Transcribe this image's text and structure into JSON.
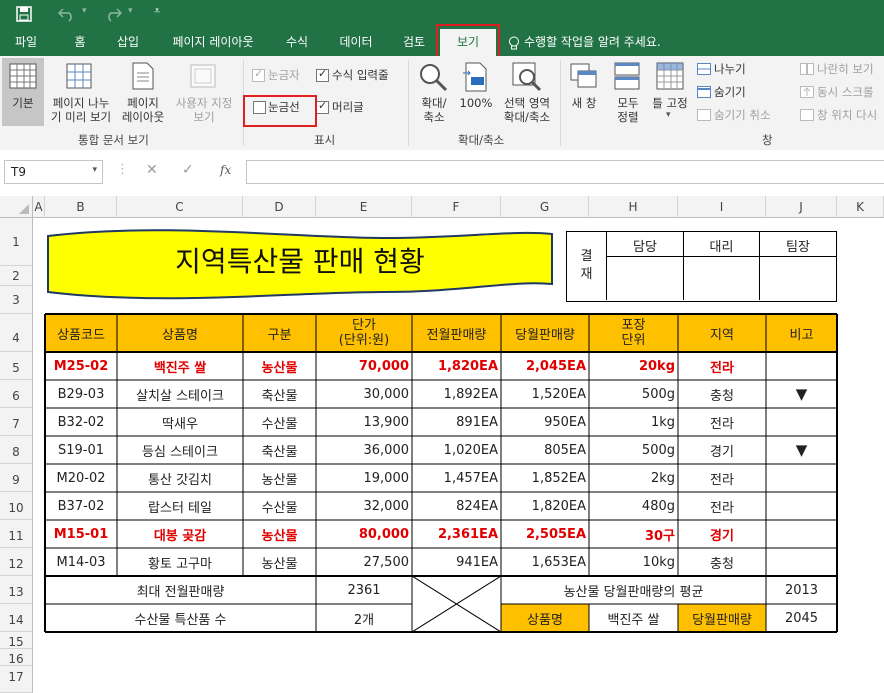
{
  "qat": {
    "save_icon": "save-icon",
    "undo_icon": "undo-icon",
    "redo_icon": "redo-icon"
  },
  "tabs": [
    {
      "label": "파일"
    },
    {
      "label": "홈"
    },
    {
      "label": "삽입"
    },
    {
      "label": "페이지 레이아웃"
    },
    {
      "label": "수식"
    },
    {
      "label": "데이터"
    },
    {
      "label": "검토"
    },
    {
      "label": "보기"
    }
  ],
  "tell_me": "수행할 작업을 알려 주세요.",
  "ribbon": {
    "views": {
      "normal": "기본",
      "page_break_1": "페이지 나누",
      "page_break_2": "기 미리 보기",
      "page_layout_1": "페이지",
      "page_layout_2": "레이아웃",
      "custom_1": "사용자 지정",
      "custom_2": "보기",
      "group": "통합 문서 보기"
    },
    "show": {
      "ruler": "눈금자",
      "formula_bar": "수식 입력줄",
      "gridlines": "눈금선",
      "headings": "머리글",
      "group": "표시"
    },
    "zoom": {
      "zoom_1": "확대/",
      "zoom_2": "축소",
      "hundred": "100%",
      "sel_1": "선택 영역",
      "sel_2": "확대/축소",
      "group": "확대/축소"
    },
    "window": {
      "new_window": "새 창",
      "arrange_1": "모두",
      "arrange_2": "정렬",
      "freeze": "틀 고정",
      "split": "나누기",
      "hide": "숨기기",
      "unhide": "숨기기 취소",
      "side_by_side": "나란히 보기",
      "sync_scroll": "동시 스크롤",
      "reset_pos": "창 위치 다시",
      "group": "창"
    }
  },
  "formula_bar": {
    "name_box": "T9",
    "fx": "fx",
    "value": ""
  },
  "columns": [
    "A",
    "B",
    "C",
    "D",
    "E",
    "F",
    "G",
    "H",
    "I",
    "J",
    "K"
  ],
  "rows": [
    "1",
    "2",
    "3",
    "4",
    "5",
    "6",
    "7",
    "8",
    "9",
    "10",
    "11",
    "12",
    "13",
    "14",
    "15",
    "16",
    "17"
  ],
  "sheet": {
    "title": "지역특산물 판매 현황",
    "approval": {
      "label_1": "결",
      "label_2": "재",
      "staff": "담당",
      "deputy": "대리",
      "manager": "팀장"
    },
    "headers": {
      "code": "상품코드",
      "name": "상품명",
      "type": "구분",
      "price_1": "단가",
      "price_2": "(단위:원)",
      "last_month": "전월판매량",
      "this_month": "당월판매량",
      "pack_1": "포장",
      "pack_2": "단위",
      "region": "지역",
      "note": "비고"
    },
    "rows": [
      {
        "code": "M25-02",
        "name": "백진주 쌀",
        "type": "농산물",
        "price": "70,000",
        "last": "1,820EA",
        "this": "2,045EA",
        "pack": "20kg",
        "region": "전라",
        "note": "",
        "bold": true
      },
      {
        "code": "B29-03",
        "name": "살치살 스테이크",
        "type": "축산물",
        "price": "30,000",
        "last": "1,892EA",
        "this": "1,520EA",
        "pack": "500g",
        "region": "충청",
        "note": "▼",
        "bold": false
      },
      {
        "code": "B32-02",
        "name": "딱새우",
        "type": "수산물",
        "price": "13,900",
        "last": "891EA",
        "this": "950EA",
        "pack": "1kg",
        "region": "전라",
        "note": "",
        "bold": false
      },
      {
        "code": "S19-01",
        "name": "등심 스테이크",
        "type": "축산물",
        "price": "36,000",
        "last": "1,020EA",
        "this": "805EA",
        "pack": "500g",
        "region": "경기",
        "note": "▼",
        "bold": false
      },
      {
        "code": "M20-02",
        "name": "통산 갓김치",
        "type": "농산물",
        "price": "19,000",
        "last": "1,457EA",
        "this": "1,852EA",
        "pack": "2kg",
        "region": "전라",
        "note": "",
        "bold": false
      },
      {
        "code": "B37-02",
        "name": "랍스터 테일",
        "type": "수산물",
        "price": "32,000",
        "last": "824EA",
        "this": "1,820EA",
        "pack": "480g",
        "region": "전라",
        "note": "",
        "bold": false
      },
      {
        "code": "M15-01",
        "name": "대봉 곶감",
        "type": "농산물",
        "price": "80,000",
        "last": "2,361EA",
        "this": "2,505EA",
        "pack": "30구",
        "region": "경기",
        "note": "",
        "bold": true
      },
      {
        "code": "M14-03",
        "name": "황토 고구마",
        "type": "농산물",
        "price": "27,500",
        "last": "941EA",
        "this": "1,653EA",
        "pack": "10kg",
        "region": "충청",
        "note": "",
        "bold": false
      }
    ],
    "summary": {
      "max_label": "최대 전월판매량",
      "max_value": "2361",
      "seafood_label": "수산물 특산품 수",
      "seafood_value": "2개",
      "avg_label": "농산물 당월판매량의 평균",
      "avg_value": "2013",
      "lookup_name_label": "상품명",
      "lookup_name_value": "백진주 쌀",
      "lookup_sales_label": "당월판매량",
      "lookup_sales_value": "2045"
    }
  },
  "colors": {
    "excel_green": "#217346",
    "header_fill": "#ffc000",
    "highlight_red": "#e00000",
    "title_fill": "#ffff00"
  }
}
